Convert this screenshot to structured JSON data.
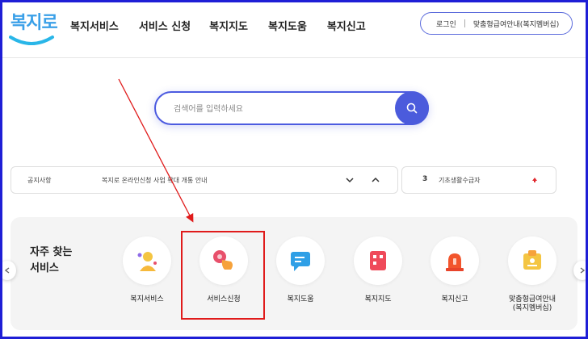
{
  "header": {
    "logo_text": "복지로",
    "nav": [
      "복지서비스",
      "서비스 신청",
      "복지지도",
      "복지도움",
      "복지신고"
    ],
    "login": "로그인",
    "custom_guide": "맞춤형급여안내(복지멤버십)"
  },
  "search": {
    "placeholder": "검색어를 입력하세요",
    "value": ""
  },
  "notice": {
    "label": "공지사항",
    "text": "복지로 온라인신청 사업 확대 개통 안내"
  },
  "ranking": {
    "rank": "3",
    "keyword": "기초생활수급자"
  },
  "favorites": {
    "title_line1": "자주 찾는",
    "title_line2": "서비스",
    "items": [
      {
        "label": "복지서비스",
        "icon": "person-icon"
      },
      {
        "label": "서비스신청",
        "icon": "hand-click-icon"
      },
      {
        "label": "복지도움",
        "icon": "chat-bubble-icon"
      },
      {
        "label": "복지지도",
        "icon": "map-icon"
      },
      {
        "label": "복지신고",
        "icon": "siren-icon"
      },
      {
        "label": "맞춤형급여안내",
        "label2": "(복지멤버십)",
        "icon": "member-card-icon"
      }
    ]
  },
  "colors": {
    "accent": "#4b5bdc",
    "frame": "#1e1ed6",
    "annotation": "#e01b1b",
    "rank_up": "#e0282e"
  }
}
